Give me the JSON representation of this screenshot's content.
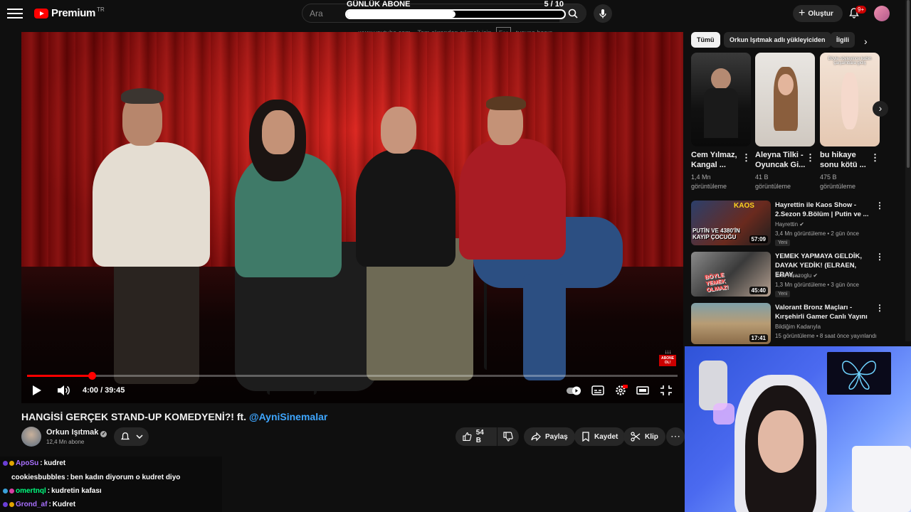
{
  "header": {
    "logo_text": "Premium",
    "country_code": "TR",
    "search_placeholder": "Ara",
    "create_label": "Oluştur",
    "notification_count": "9+"
  },
  "goal": {
    "title": "GÜNLÜK ABONE",
    "current": "5",
    "total": "10",
    "count_text": "5  / 10",
    "progress_fraction": 0.5
  },
  "fullscreen_hint": {
    "prefix": "www.youtube.com – Tam ekrandan çıkmak için",
    "key": "Esc",
    "suffix": "tuşuna basın"
  },
  "player": {
    "current_time": "4:00",
    "duration": "39:45",
    "time_text": "4:00 / 39:45",
    "progress_fraction": 0.1,
    "overlay_arrows": "↓↓↓",
    "overlay_text": "ABONE OL!"
  },
  "video": {
    "title": "HANGİSİ GERÇEK STAND-UP KOMEDYENİ?! ft.",
    "mention": "@AyniSinemalar",
    "channel": "Orkun Işıtmak",
    "subscribers": "12,4 Mn abone",
    "likes": "54 B",
    "share": "Paylaş",
    "save": "Kaydet",
    "clip": "Klip"
  },
  "chat": [
    {
      "user": "ApoSu",
      "color": "#a970ff",
      "message": "kudret"
    },
    {
      "user": "cookiesbubbles",
      "color": "#ffffff",
      "message": "ben kadın diyorum o kudret diyo"
    },
    {
      "user": "omertnql",
      "color": "#00ff7f",
      "message": "kudretin kafası"
    },
    {
      "user": "Grond_af",
      "color": "#a970ff",
      "message": "Kudret"
    }
  ],
  "chips": [
    "Tümü",
    "Orkun Işıtmak adlı yükleyiciden",
    "İlgili"
  ],
  "shorts": [
    {
      "title": "Cem Yılmaz, Kangal ...",
      "views": "1,4 Mn",
      "views_label": "görüntüleme"
    },
    {
      "title": "Aleyna Tilki - Oyuncak Gi...",
      "views": "41 B",
      "views_label": "görüntüleme"
    },
    {
      "title": "bu hikaye sonu kötü ...",
      "views": "475 B",
      "views_label": "görüntüleme"
    }
  ],
  "short_caption": "Böyle söyleyince kabin çarşamba/a gidiş",
  "recommendations": [
    {
      "title": "Hayrettin ile Kaos Show - 2.Sezon 9.Bölüm | Putin ve ...",
      "channel": "Hayrettin",
      "meta": "3,4 Mn görüntüleme • 2 gün önce",
      "badge": "Yeni",
      "duration": "57:09",
      "thumb_text": "PUTİN VE 4380'İN KAYIP ÇOCUĞU",
      "thumb_top": "KAOS"
    },
    {
      "title": "YEMEK YAPMAYA GELDİK, DAYAK YEDİK! (ELRAEN, ERAY,...",
      "channel": "Enis Kirazoglu",
      "meta": "1,3 Mn görüntüleme • 3 gün önce",
      "badge": "Yeni",
      "duration": "45:40",
      "thumb_text": "BÖYLE YEMEK OLMAZ!"
    },
    {
      "title": "Valorant Bronz Maçları - Kırşehirli Gamer Canlı Yayını",
      "channel": "Bildiğim Kadarıyla",
      "meta": "15 görüntüleme • 8 saat önce yayınlandı",
      "badge": "Yeni",
      "duration": "17:41"
    }
  ],
  "colors": {
    "accent": "#ff0000",
    "link": "#3ea6ff",
    "background": "#0f0f0f"
  }
}
